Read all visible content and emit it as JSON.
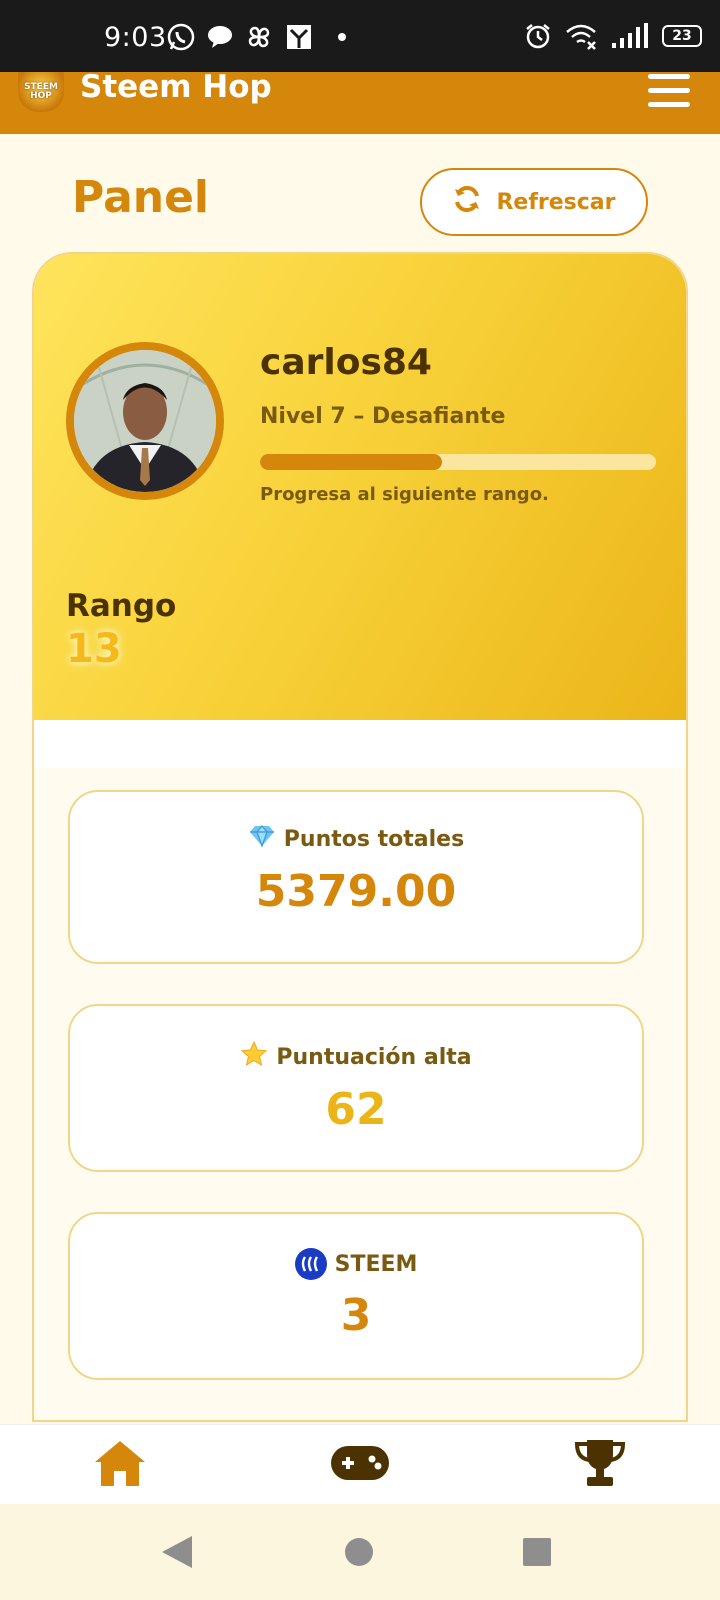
{
  "status_bar": {
    "time": "9:03",
    "battery": "23",
    "notification_icons": [
      "whatsapp-icon",
      "chat-icon",
      "pinwheel-icon",
      "app-icon",
      "dot-icon"
    ],
    "system_icons": [
      "alarm-icon",
      "wifi-icon",
      "signal-icon",
      "battery-icon"
    ]
  },
  "header": {
    "logo_text": "STEEM HOP",
    "title": "Steem Hop"
  },
  "page": {
    "title": "Panel",
    "refresh_label": "Refrescar"
  },
  "profile": {
    "username": "carlos84",
    "level": "Nivel 7 – Desafiante",
    "progress": 0.46,
    "progress_hint": "Progresa al siguiente rango.",
    "rank_label": "Rango",
    "rank_value": "13"
  },
  "stats": [
    {
      "icon": "gem-icon",
      "label": "Puntos totales",
      "value": "5379.00"
    },
    {
      "icon": "star-icon",
      "label": "Puntuación alta",
      "value": "62"
    },
    {
      "icon": "steem-icon",
      "label": "STEEM",
      "value": "3"
    }
  ],
  "bottom_nav": [
    "home-icon",
    "gamepad-icon",
    "trophy-icon"
  ],
  "colors": {
    "brand": "#d4870a",
    "gold": "#ebb519",
    "text_dark": "#4b3200",
    "background": "#fffaea"
  }
}
